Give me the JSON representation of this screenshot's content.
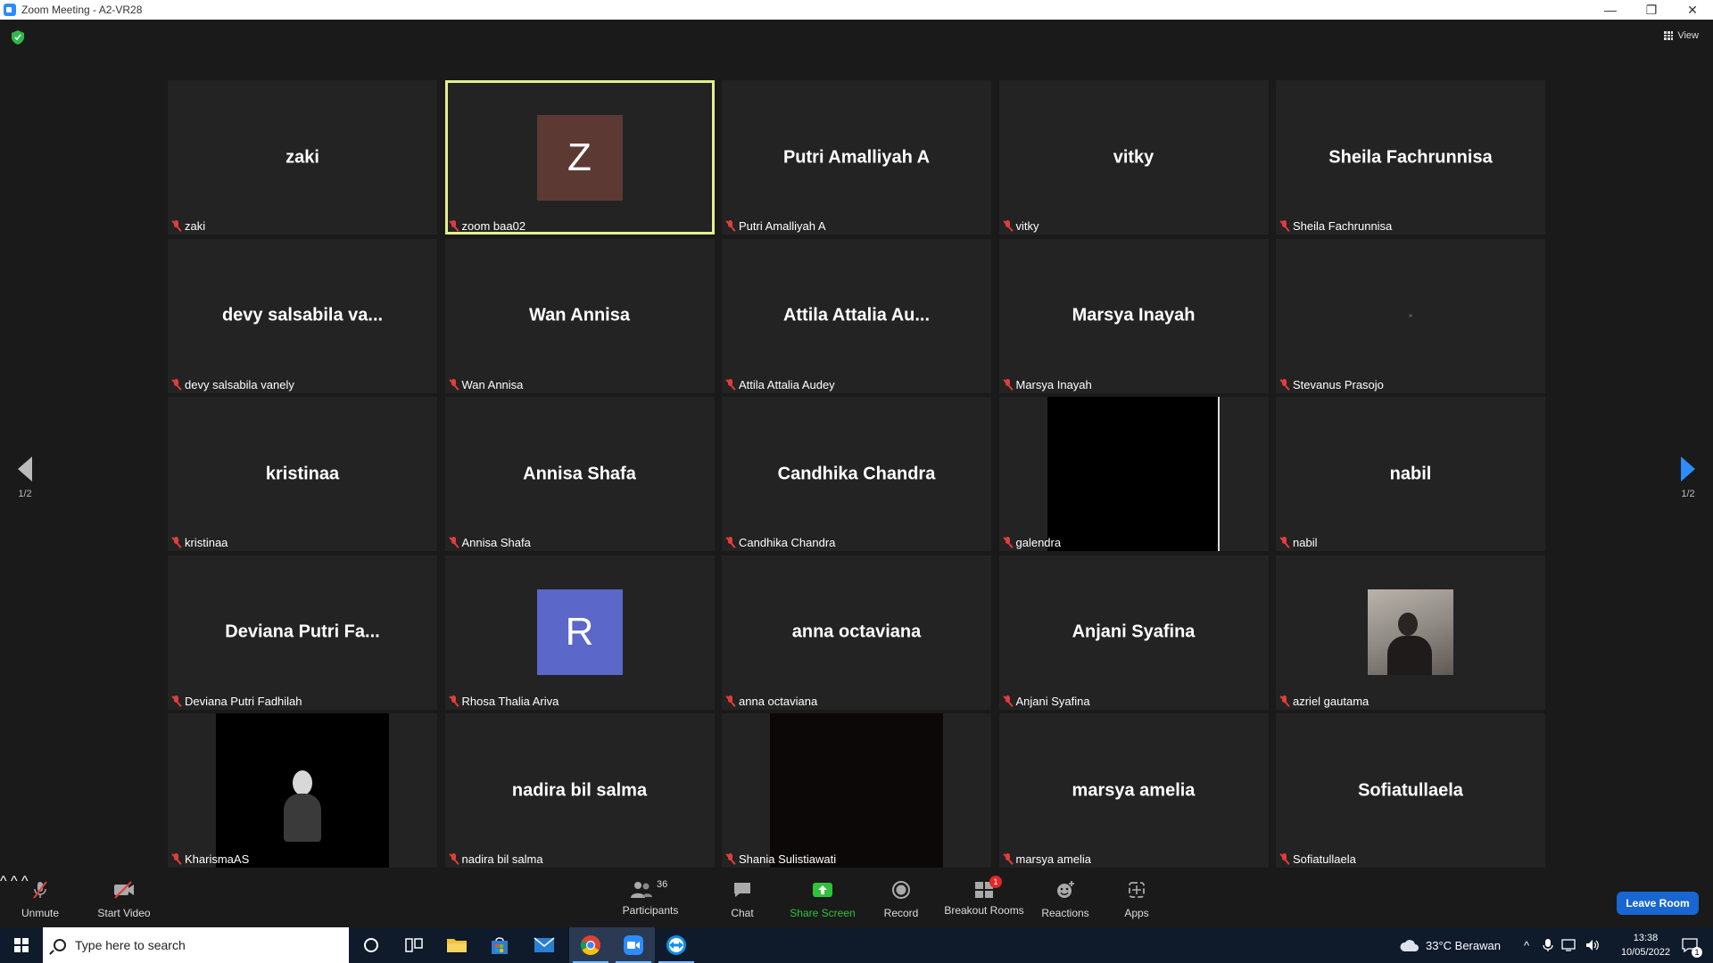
{
  "window": {
    "title": "Zoom Meeting - A2-VR28",
    "minimize": "—",
    "restore": "❐",
    "close": "✕"
  },
  "meeting": {
    "view_label": "View",
    "page_left": "1/2",
    "page_right": "1/2",
    "active_tile_index": 1
  },
  "participants": [
    {
      "display": "zaki",
      "label": "zaki",
      "kind": "name"
    },
    {
      "display": "Z",
      "label": "zoom baa02",
      "kind": "avatar",
      "avatar_color": "#5c3a33"
    },
    {
      "display": "Putri Amalliyah A",
      "label": "Putri Amalliyah A",
      "kind": "name"
    },
    {
      "display": "vitky",
      "label": "vitky",
      "kind": "name"
    },
    {
      "display": "Sheila Fachrunnisa",
      "label": "Sheila Fachrunnisa",
      "kind": "name"
    },
    {
      "display": "devy salsabila va...",
      "label": "devy salsabila vanely",
      "kind": "name"
    },
    {
      "display": "Wan Annisa",
      "label": "Wan Annisa",
      "kind": "name"
    },
    {
      "display": "Attila Attalia Au...",
      "label": "Attila Attalia Audey",
      "kind": "name"
    },
    {
      "display": "Marsya Inayah",
      "label": "Marsya Inayah",
      "kind": "name"
    },
    {
      "display": "",
      "label": "Stevanus Prasojo",
      "kind": "blank"
    },
    {
      "display": "kristinaa",
      "label": "kristinaa",
      "kind": "name"
    },
    {
      "display": "Annisa Shafa",
      "label": "Annisa Shafa",
      "kind": "name"
    },
    {
      "display": "Candhika Chandra",
      "label": "Candhika Chandra",
      "kind": "name"
    },
    {
      "display": "",
      "label": "galendra",
      "kind": "video"
    },
    {
      "display": "nabil",
      "label": "nabil",
      "kind": "name"
    },
    {
      "display": "Deviana Putri Fa...",
      "label": "Deviana Putri Fadhilah",
      "kind": "name"
    },
    {
      "display": "R",
      "label": "Rhosa Thalia Ariva",
      "kind": "avatar",
      "avatar_color": "#5b67c9"
    },
    {
      "display": "anna octaviana",
      "label": "anna octaviana",
      "kind": "name"
    },
    {
      "display": "Anjani Syafina",
      "label": "Anjani Syafina",
      "kind": "name"
    },
    {
      "display": "",
      "label": "azriel gautama",
      "kind": "photo"
    },
    {
      "display": "",
      "label": "KharismaAS",
      "kind": "video-person"
    },
    {
      "display": "nadira bil salma",
      "label": "nadira bil salma",
      "kind": "name"
    },
    {
      "display": "",
      "label": "Shania Sulistiawati",
      "kind": "video-dark"
    },
    {
      "display": "marsya amelia",
      "label": "marsya amelia",
      "kind": "name"
    },
    {
      "display": "Sofiatullaela",
      "label": "Sofiatullaela",
      "kind": "name"
    }
  ],
  "controls": {
    "unmute": "Unmute",
    "start_video": "Start Video",
    "participants": "Participants",
    "participants_count": "36",
    "chat": "Chat",
    "share_screen": "Share Screen",
    "record": "Record",
    "breakout_rooms": "Breakout Rooms",
    "breakout_badge": "1",
    "reactions": "Reactions",
    "apps": "Apps",
    "leave_room": "Leave Room",
    "caret": "^"
  },
  "taskbar": {
    "search_placeholder": "Type here to search",
    "weather": "33°C  Berawan",
    "time": "13:38",
    "date": "10/05/2022",
    "notification_count": "1",
    "tray_up": "^"
  },
  "colors": {
    "accent": "#2d8cff",
    "active_border": "#e4f08c",
    "share_green": "#31c23a",
    "mute_red": "#e23c3c",
    "leave_blue": "#1766d1"
  }
}
